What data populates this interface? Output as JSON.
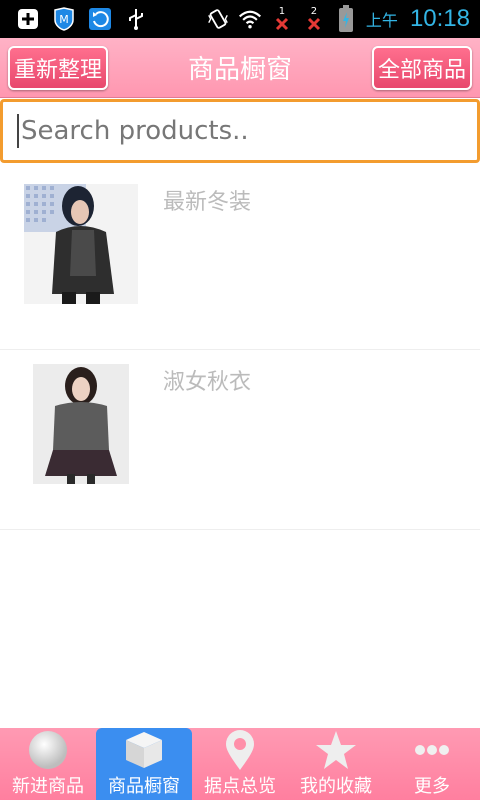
{
  "status_bar": {
    "ampm": "上午",
    "time": "10:18",
    "sim1": "1",
    "sim2": "2",
    "icons": [
      "add-icon",
      "shield-icon",
      "refresh-icon",
      "usb-icon",
      "vibrate-icon",
      "wifi-icon",
      "signal-icon",
      "battery-icon"
    ]
  },
  "title_bar": {
    "left_button": "重新整理",
    "title": "商品橱窗",
    "right_button": "全部商品"
  },
  "search": {
    "placeholder": "Search products.."
  },
  "products": [
    {
      "title": "最新冬装"
    },
    {
      "title": "淑女秋衣"
    }
  ],
  "bottom_nav": {
    "active_index": 1,
    "items": [
      {
        "label": "新进商品",
        "icon": "circle-icon"
      },
      {
        "label": "商品橱窗",
        "icon": "box-icon"
      },
      {
        "label": "据点总览",
        "icon": "map-pin-icon"
      },
      {
        "label": "我的收藏",
        "icon": "star-icon"
      },
      {
        "label": "更多",
        "icon": "more-icon"
      }
    ]
  },
  "colors": {
    "header_pink": "#ff9ab3",
    "button_pink": "#e8486d",
    "active_tab": "#3b8ef0",
    "search_border": "#f39c2f",
    "clock_blue": "#33b5e5"
  }
}
